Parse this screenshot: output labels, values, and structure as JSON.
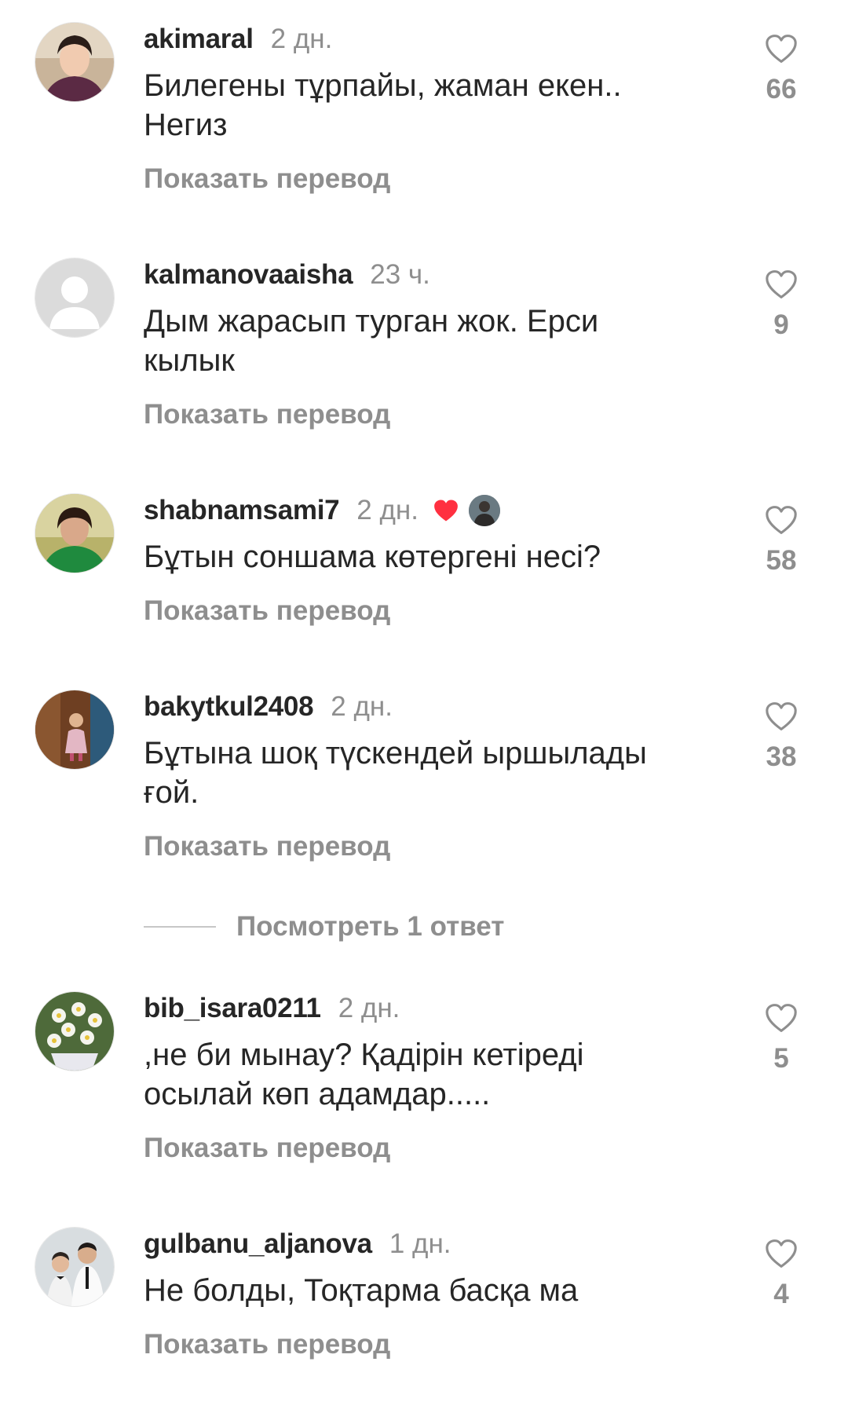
{
  "comments": [
    {
      "username": "akimaral",
      "time": "2 дн.",
      "text_lines": [
        "Билегены тұрпайы, жаман екен..",
        "Негиз"
      ],
      "translate_label": "Показать перевод",
      "likes": "66",
      "avatar": "photo-woman-avatar"
    },
    {
      "username": "kalmanovaaisha",
      "time": "23 ч.",
      "text_lines": [
        "Дым жарасып турган жок. Ерси",
        "кылык"
      ],
      "translate_label": "Показать перевод",
      "likes": "9",
      "avatar": "default-user-avatar"
    },
    {
      "username": "shabnamsami7",
      "time": "2 дн.",
      "text_lines": [
        "Бұтын соншама көтергені несі?"
      ],
      "translate_label": "Показать перевод",
      "likes": "58",
      "avatar": "photo-woman-green-avatar",
      "author_liked": true
    },
    {
      "username": "bakytkul2408",
      "time": "2 дн.",
      "text_lines": [
        "Бұтына шоқ түскендей ыршылады",
        "ғой."
      ],
      "translate_label": "Показать перевод",
      "likes": "38",
      "avatar": "photo-child-avatar"
    },
    {
      "username": "bib_isara0211",
      "time": "2 дн.",
      "text_lines": [
        ",не би мынау? Қадірін кетіреді",
        "осылай көп адамдар....."
      ],
      "translate_label": "Показать перевод",
      "likes": "5",
      "avatar": "photo-flowers-avatar"
    },
    {
      "username": "gulbanu_aljanova",
      "time": "1 дн.",
      "text_lines": [
        "Не болды, Тоқтарма басқа ма"
      ],
      "translate_label": "Показать перевод",
      "likes": "4",
      "avatar": "photo-boys-avatar"
    }
  ],
  "view_replies_label": "Посмотреть 1 ответ",
  "colors": {
    "text": "#262626",
    "secondary": "#8e8e8e",
    "heart_red": "#ff3040"
  }
}
